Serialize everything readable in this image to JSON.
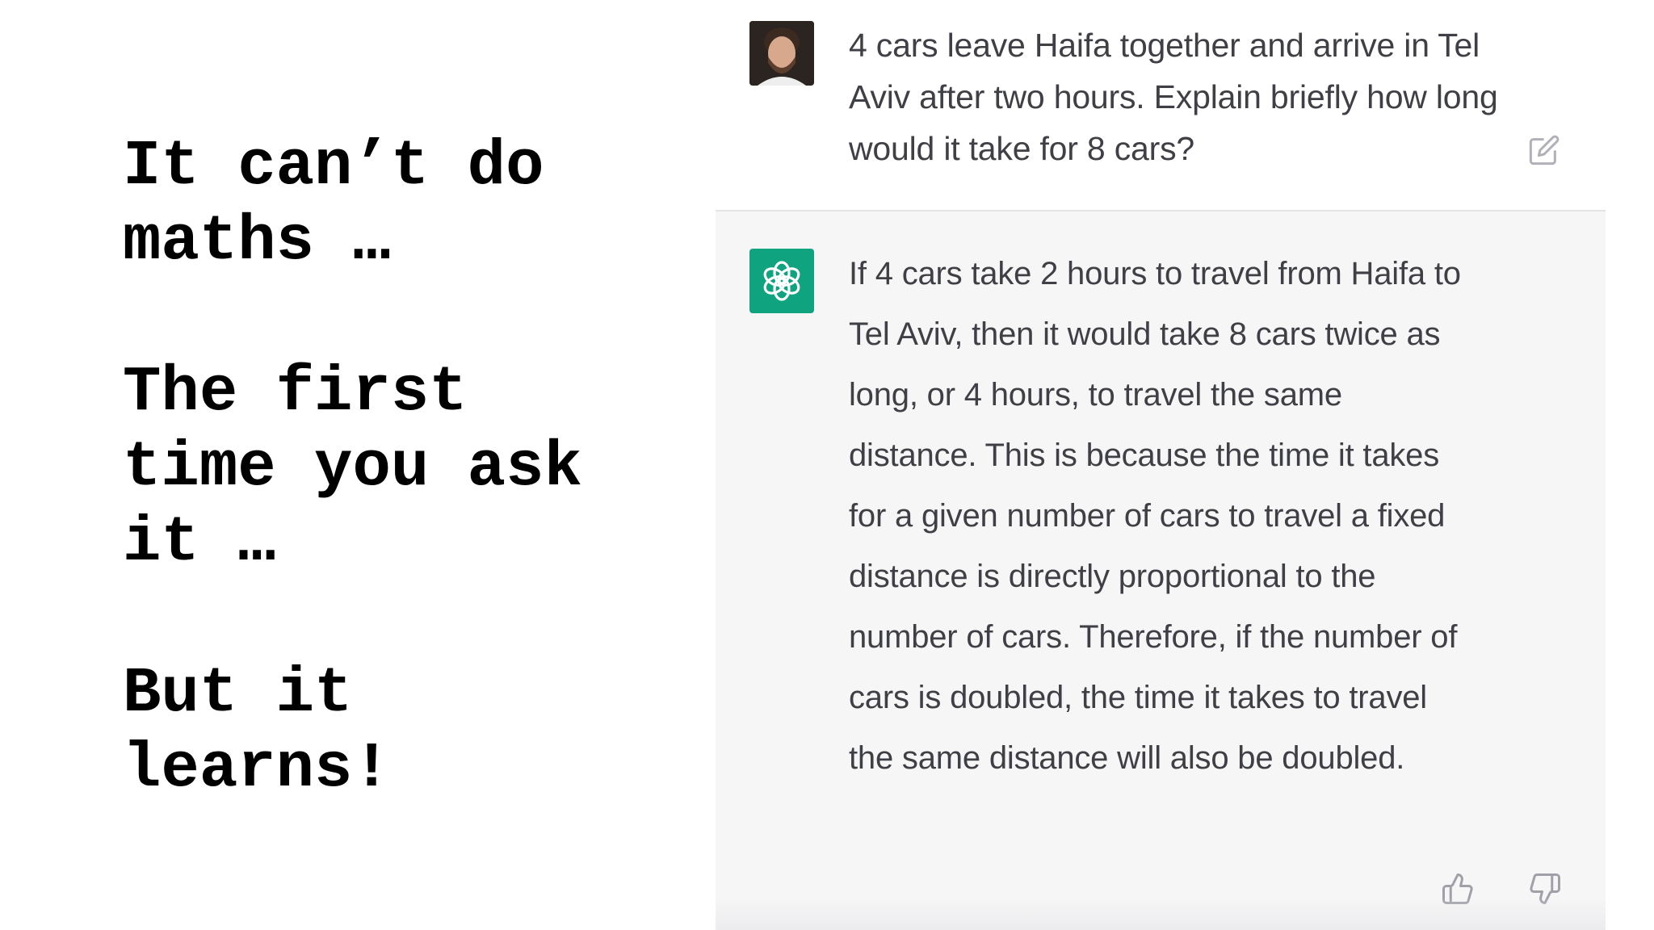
{
  "caption": {
    "lines_a": [
      "It can’t do",
      "maths …"
    ],
    "lines_b": [
      "The first",
      "time you ask",
      "it …"
    ],
    "lines_c": [
      "But it",
      "learns!"
    ]
  },
  "chat": {
    "user_message": "4 cars leave Haifa together and arrive in Tel Aviv after two hours. Explain briefly how long would it take for 8 cars?",
    "assistant_message": "If 4 cars take 2 hours to travel from Haifa to Tel Aviv, then it would take 8 cars twice as long, or 4 hours, to travel the same distance. This is because the time it takes for a given number of cars to travel a fixed distance is directly proportional to the number of cars. Therefore, if the number of cars is doubled, the time it takes to travel the same distance will also be doubled."
  },
  "icons": {
    "user_avatar": "user-avatar",
    "assistant_avatar": "openai-logo-icon",
    "edit": "edit-icon",
    "thumbs_up": "thumbs-up-icon",
    "thumbs_down": "thumbs-down-icon"
  },
  "colors": {
    "assistant_avatar_bg": "#10a37f",
    "text": "#3f3f46",
    "panel_bg": "#f6f6f7"
  }
}
